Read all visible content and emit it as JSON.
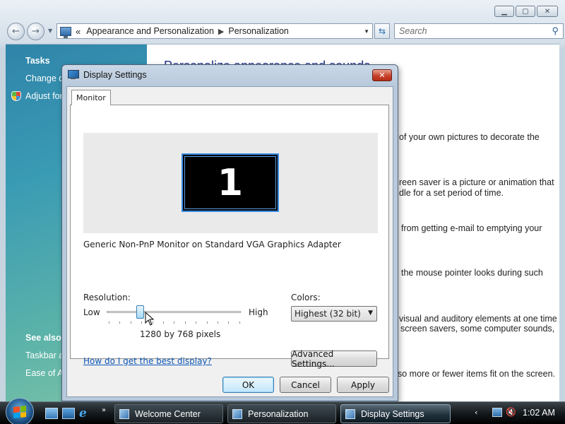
{
  "explorer": {
    "back_arrow": "←",
    "forward_arrow": "→",
    "breadcrumb_chevron": "«",
    "breadcrumb": [
      "Appearance and Personalization",
      "Personalization"
    ],
    "breadcrumb_separator": "▶",
    "search_placeholder": "Search",
    "tasks_heading": "Tasks",
    "tasks": [
      "Change d",
      "Adjust for"
    ],
    "see_also_heading": "See also",
    "see_also": [
      "Taskbar a",
      "Ease of Ac"
    ],
    "heading_fragment": "Personalize appearance and sounds",
    "content_lines": [
      "of your own pictures to decorate the",
      "reen saver is a picture or animation that",
      "dle for a set period of time.",
      "from getting e-mail to emptying your",
      "the mouse pointer looks during such",
      "visual and auditory elements at one time",
      "screen savers, some computer sounds,",
      "so more or fewer items fit on the screen."
    ]
  },
  "dialog": {
    "title": "Display Settings",
    "close_glyph": "✕",
    "tab_label": "Monitor",
    "monitor_number": "1",
    "adapter": "Generic Non-PnP Monitor on Standard VGA Graphics Adapter",
    "resolution_label": "Resolution:",
    "low_label": "Low",
    "high_label": "High",
    "resolution_value": "1280 by 768 pixels",
    "resolution_slider_position": 0.25,
    "colors_label": "Colors:",
    "colors_value": "Highest (32 bit)",
    "advanced_button": "Advanced Settings...",
    "help_link": "How do I get the best display?",
    "ok_button": "OK",
    "cancel_button": "Cancel",
    "apply_button": "Apply"
  },
  "taskbar": {
    "tasks": [
      "Welcome Center",
      "Personalization",
      "Display Settings"
    ],
    "active_task": "Display Settings",
    "quicklaunch_more": "»",
    "tray_arrow": "‹",
    "clock": "1:02 AM"
  },
  "colors": {
    "link_blue": "#0f58b7",
    "monitor_highlight": "#3d8ee6",
    "left_pane_top": "#2f84a9",
    "left_pane_bottom": "#7cc3a8"
  }
}
